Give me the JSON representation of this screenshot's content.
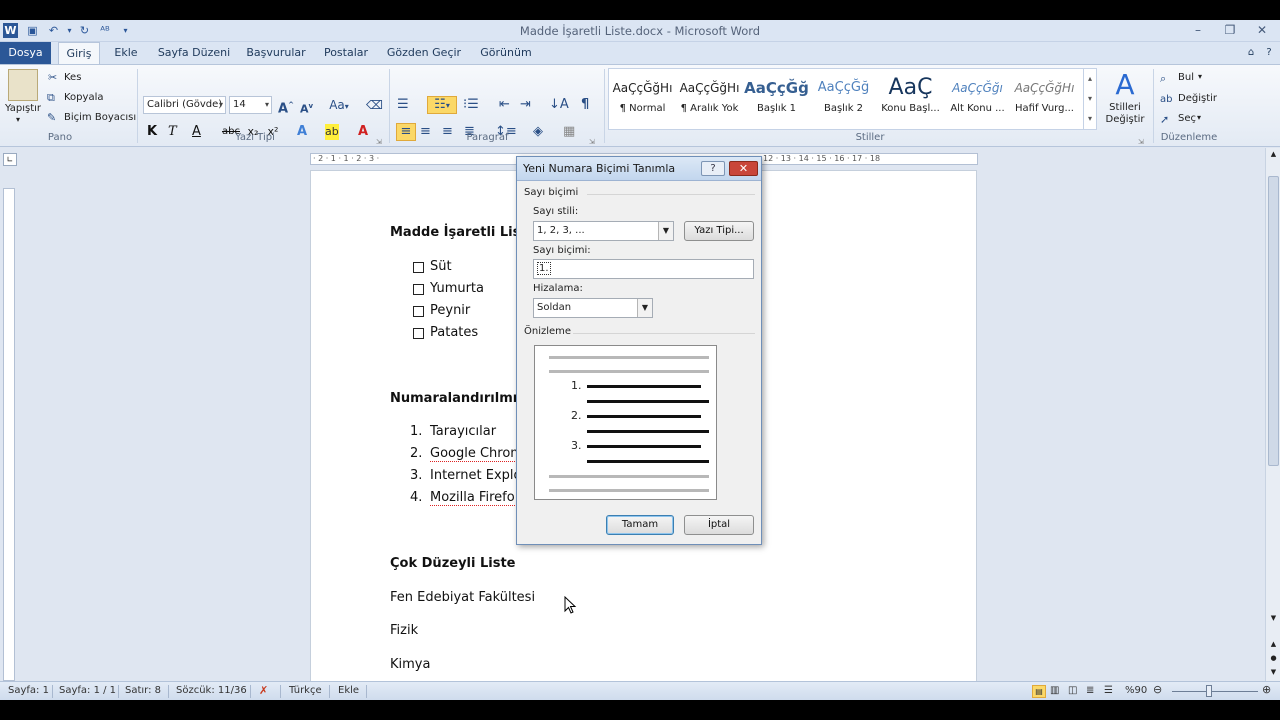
{
  "window": {
    "title": "Madde İşaretli Liste.docx - Microsoft Word",
    "minimize_glyph": "–",
    "maximize_glyph": "❐",
    "close_glyph": "✕"
  },
  "tabs": [
    "Dosya",
    "Giriş",
    "Ekle",
    "Sayfa Düzeni",
    "Başvurular",
    "Postalar",
    "Gözden Geçir",
    "Görünüm"
  ],
  "ribbon": {
    "pano": {
      "paste_label": "Yapıştır",
      "cut": "Kes",
      "copy": "Kopyala",
      "format_painter": "Biçim Boyacısı",
      "group_label": "Pano"
    },
    "font": {
      "name": "Calibri (Gövde)",
      "size": "14",
      "group_label": "Yazı Tipi",
      "bold": "K",
      "italic": "T",
      "underline": "A",
      "strike": "abc",
      "sub": "x₂",
      "sup": "x²"
    },
    "paragraph": {
      "group_label": "Paragraf",
      "pilcrow": "¶"
    },
    "styles": {
      "group_label": "Stiller",
      "items": [
        {
          "sample": "AaÇçĞğHı",
          "name": "¶ Normal"
        },
        {
          "sample": "AaÇçĞğHı",
          "name": "¶ Aralık Yok"
        },
        {
          "sample": "AaÇçĞğ",
          "name": "Başlık 1"
        },
        {
          "sample": "AaÇçĞğ",
          "name": "Başlık 2"
        },
        {
          "sample": "AaÇ",
          "name": "Konu Başl..."
        },
        {
          "sample": "AaÇçĞğı",
          "name": "Alt Konu ..."
        },
        {
          "sample": "AaÇçĞğHı",
          "name": "Hafif Vurg..."
        }
      ],
      "change_styles": "Stilleri Değiştir"
    },
    "editing": {
      "find": "Bul",
      "replace": "Değiştir",
      "select": "Seç",
      "group_label": "Düzenleme"
    }
  },
  "ruler_text": "· 2 · 1 · 1 · 2 · 3 ·",
  "ruler_text_right": "12 · 13 · 14 · 15 · 16 · 17 · 18",
  "document": {
    "heading1": "Madde İşaretli Liste",
    "bullets": [
      "Süt",
      "Yumurta",
      "Peynir",
      "Patates"
    ],
    "heading2": "Numaralandırılmış L",
    "numbered": [
      {
        "num": "1.",
        "text": "Tarayıcılar"
      },
      {
        "num": "2.",
        "text": "Google Chrom"
      },
      {
        "num": "3.",
        "text": "Internet Explo"
      },
      {
        "num": "4.",
        "text": "Mozilla Firefo"
      }
    ],
    "heading3": "Çok Düzeyli Liste",
    "lines": [
      "Fen Edebiyat Fakültesi",
      "Fizik",
      "Kimya"
    ]
  },
  "dialog": {
    "title": "Yeni Numara Biçimi Tanımla",
    "help": "?",
    "close": "✕",
    "section_number_format": "Sayı biçimi",
    "number_style_label": "Sayı stili:",
    "number_style_value": "1, 2, 3, ...",
    "font_button": "Yazı Tipi...",
    "number_format_label": "Sayı biçimi:",
    "number_format_value": "1.",
    "alignment_label": "Hizalama:",
    "alignment_value": "Soldan",
    "preview_label": "Önizleme",
    "preview_numbers": [
      "1.",
      "2.",
      "3."
    ],
    "ok_button": "Tamam",
    "cancel_button": "İptal"
  },
  "statusbar": {
    "page": "Sayfa: 1",
    "pages": "Sayfa: 1 / 1",
    "line": "Satır: 8",
    "words": "Sözcük: 11/36",
    "language": "Türkçe",
    "mode": "Ekle",
    "zoom": "%90"
  }
}
